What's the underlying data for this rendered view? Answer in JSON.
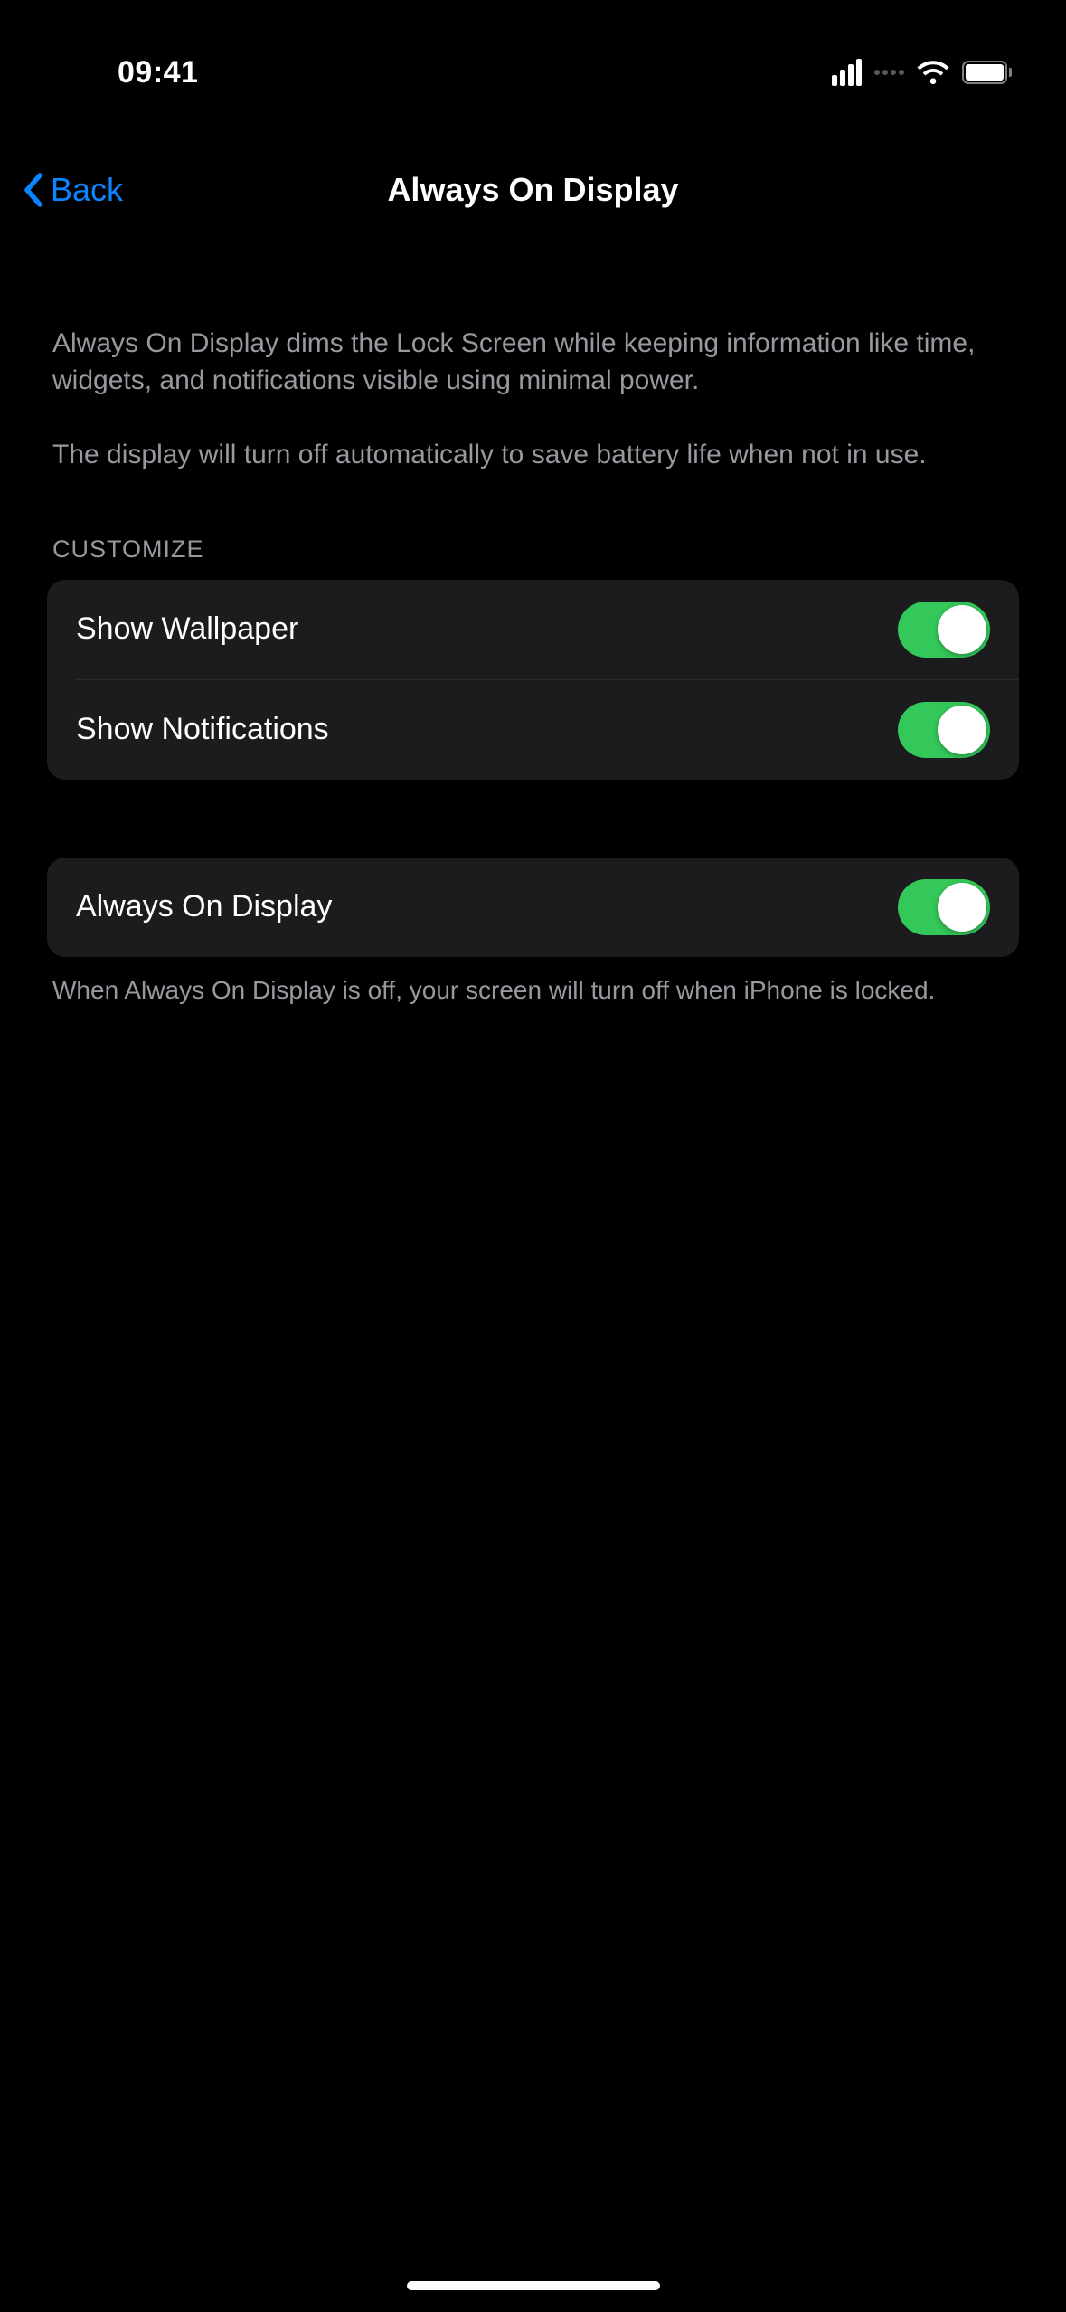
{
  "statusBar": {
    "time": "09:41"
  },
  "nav": {
    "back": "Back",
    "title": "Always On Display"
  },
  "description": {
    "p1": "Always On Display dims the Lock Screen while keeping information like time, widgets, and notifications visible using minimal power.",
    "p2": "The display will turn off automatically to save battery life when not in use."
  },
  "sections": {
    "customize": {
      "header": "CUSTOMIZE",
      "rows": {
        "wallpaper": {
          "label": "Show Wallpaper",
          "on": true
        },
        "notifications": {
          "label": "Show Notifications",
          "on": true
        }
      }
    },
    "main": {
      "rows": {
        "aod": {
          "label": "Always On Display",
          "on": true
        }
      },
      "footer": "When Always On Display is off, your screen will turn off when iPhone is locked."
    }
  }
}
